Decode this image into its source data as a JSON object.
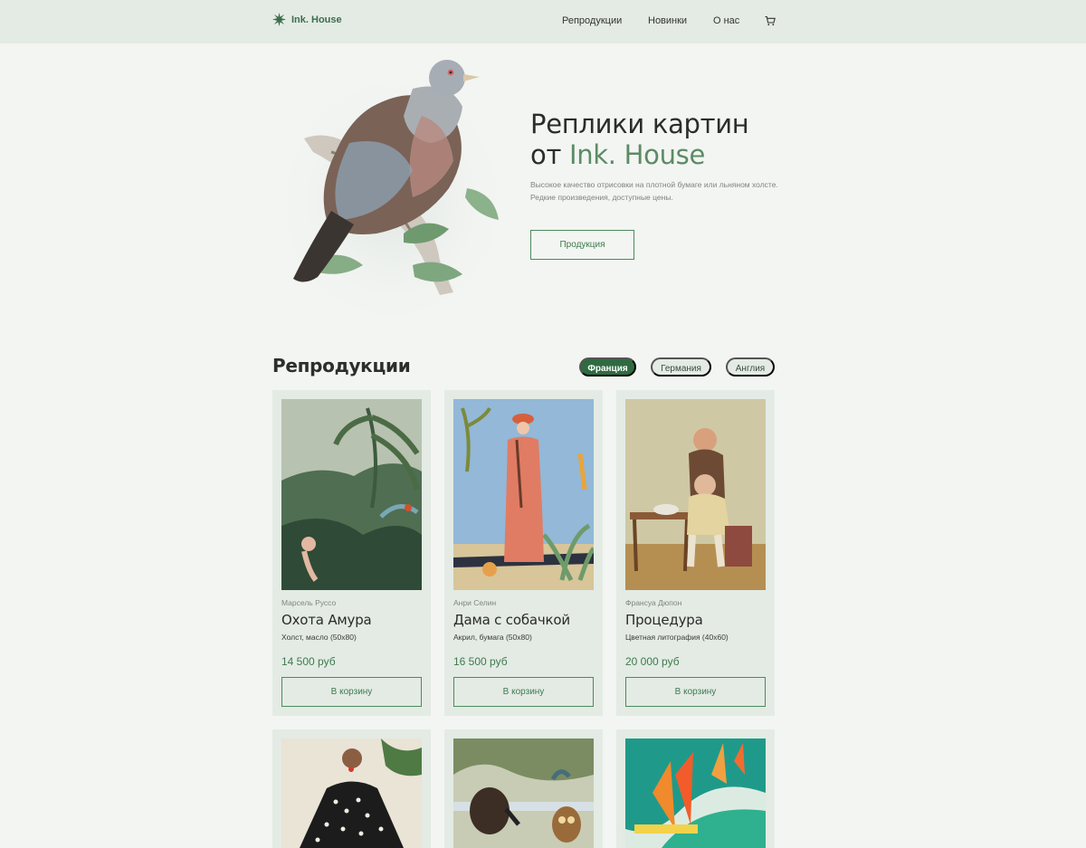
{
  "header": {
    "logo_text": "Ink. House",
    "nav": [
      "Репродукции",
      "Новинки",
      "О нас"
    ],
    "icons": {
      "logo": "starburst-logo-icon",
      "cart": "cart-icon"
    }
  },
  "hero": {
    "title_line1": "Реплики картин",
    "title_prefix": "от",
    "title_accent": "Ink. House",
    "description": "Высокое качество отрисовки на плотной бумаге или льняном холсте. Редкие произведения, доступные цены.",
    "button_label": "Продукция",
    "image": "bird-pigeon-illustration"
  },
  "reproductions": {
    "title": "Репродукции",
    "filters": [
      {
        "label": "Франция",
        "active": true
      },
      {
        "label": "Германия",
        "active": false
      },
      {
        "label": "Англия",
        "active": false
      }
    ],
    "cards": [
      {
        "artist": "Марсель Руссо",
        "title": "Охота Амура",
        "medium": "Холст, масло (50х80)",
        "price": "14 500 руб",
        "button": "В корзину"
      },
      {
        "artist": "Анри Селин",
        "title": "Дама с собачкой",
        "medium": "Акрил, бумага (50х80)",
        "price": "16 500 руб",
        "button": "В корзину"
      },
      {
        "artist": "Франсуа Дюпон",
        "title": "Процедура",
        "medium": "Цветная литография (40х60)",
        "price": "20 000 руб",
        "button": "В корзину"
      }
    ]
  },
  "colors": {
    "accent": "#2f6b40",
    "accent_text": "#5c8b66",
    "header_bg": "#e3ebe4",
    "page_bg": "#f3f5f2"
  }
}
